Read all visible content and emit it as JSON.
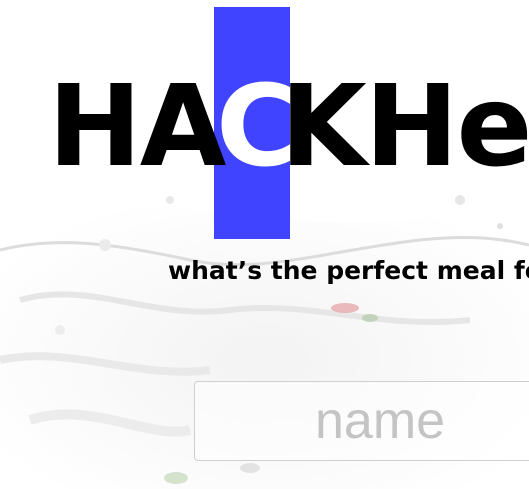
{
  "logo": {
    "prefix": "HA",
    "highlight": "C",
    "suffix": "KHe",
    "highlight_color": "#4144ff"
  },
  "tagline": "what’s the perfect meal fo",
  "name_input": {
    "placeholder": "name",
    "value": ""
  },
  "background": {
    "icon": "water-splash-image"
  }
}
